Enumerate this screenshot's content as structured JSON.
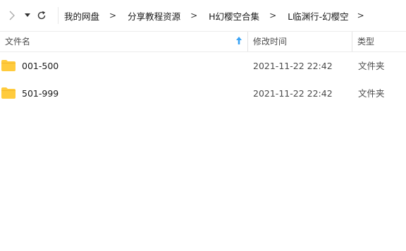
{
  "nav": {
    "forward_icon": "chevron-right-icon",
    "history_icon": "caret-down-icon",
    "refresh_icon": "refresh-icon"
  },
  "breadcrumb": {
    "items": [
      "我的网盘",
      "分享教程资源",
      "H幻樱空合集",
      "L临渊行-幻樱空"
    ],
    "separator": ">"
  },
  "columns": {
    "name": "文件名",
    "date": "修改时间",
    "type": "类型",
    "sort_icon": "sort-up-arrow-icon"
  },
  "files": [
    {
      "name": "001-500",
      "date": "2021-11-22 22:42",
      "type": "文件夹",
      "icon": "folder-icon"
    },
    {
      "name": "501-999",
      "date": "2021-11-22 22:42",
      "type": "文件夹",
      "icon": "folder-icon"
    }
  ],
  "colors": {
    "folder": "#ffcb3d",
    "sort_arrow": "#3aa3f5"
  }
}
